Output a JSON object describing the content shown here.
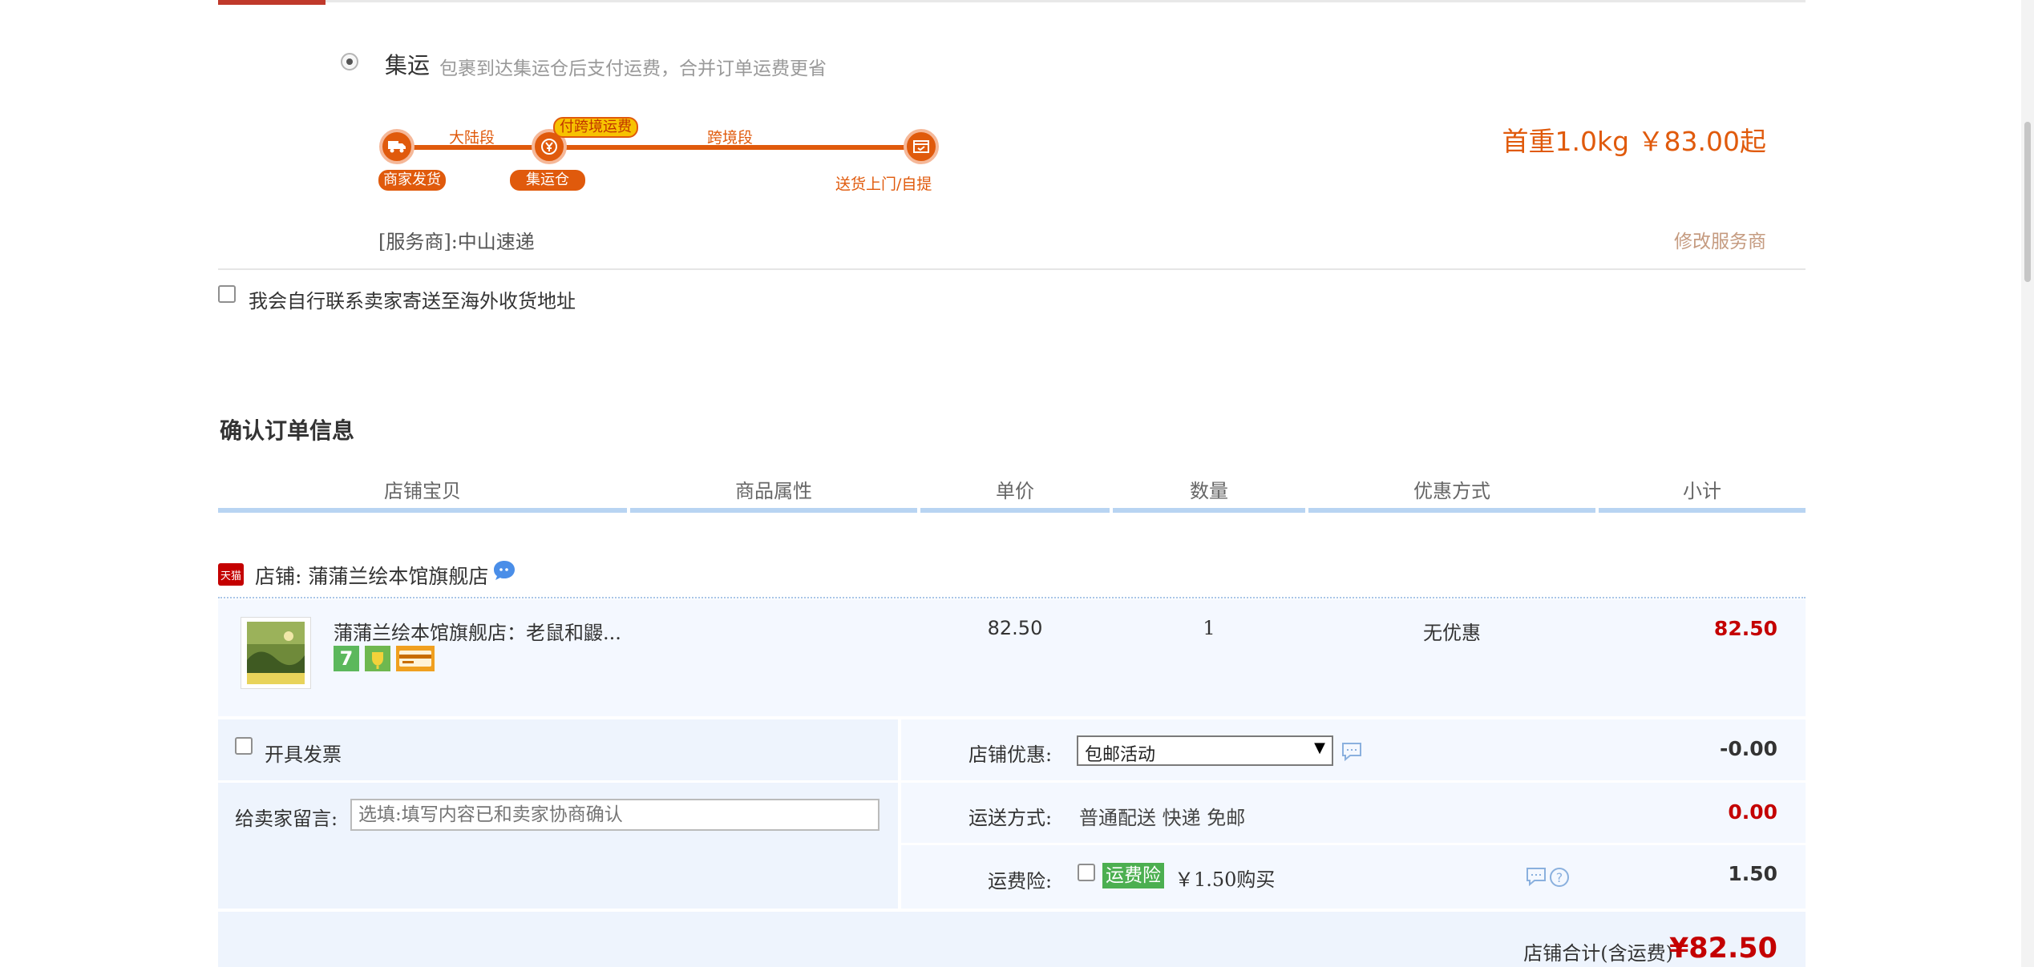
{
  "shipping": {
    "option_title": "集运",
    "option_desc": "包裹到达集运仓后支付运费，合并订单运费更省",
    "route": {
      "segment_mainland": "大陆段",
      "segment_crossborder": "跨境段",
      "pay_tag": "付跨境运费",
      "node_merchant": "商家发货",
      "node_warehouse": "集运仓",
      "node_delivery": "送货上门/自提"
    },
    "price_start": "首重1.0kg ￥83.00起",
    "provider_label": "[服务商]:中山速递",
    "change_provider": "修改服务商",
    "self_contact": "我会自行联系卖家寄送至海外收货地址"
  },
  "order": {
    "title": "确认订单信息",
    "columns": [
      "店铺宝贝",
      "商品属性",
      "单价",
      "数量",
      "优惠方式",
      "小计"
    ],
    "store": {
      "logo_text": "天猫",
      "name": "店铺: 蒲蒲兰绘本馆旗舰店"
    },
    "item": {
      "title": "蒲蒲兰绘本馆旗舰店：老鼠和鼹...",
      "price": "82.50",
      "quantity": "1",
      "discount": "无优惠",
      "subtotal": "82.50",
      "badge_7": "7"
    },
    "invoice_label": "开具发票",
    "message_label": "给卖家留言:",
    "message_placeholder": "选填:填写内容已和卖家协商确认",
    "store_discount_label": "店铺优惠:",
    "store_discount_value": "包邮活动",
    "store_discount_amount": "-0.00",
    "shipping_method_label": "运送方式:",
    "shipping_method_value": "普通配送 快递 免邮",
    "shipping_method_amount": "0.00",
    "insurance_label": "运费险:",
    "insurance_tag": "运费险",
    "insurance_price": "￥1.50购买",
    "insurance_amount": "1.50",
    "total_label": "店铺合计(含运费)",
    "total_value": "¥82.50"
  },
  "colors": {
    "accent_orange": "#e05a0c",
    "price_red": "#c40000",
    "table_header_bar": "#b8d4f2",
    "option_bg": "#eef4fd"
  }
}
